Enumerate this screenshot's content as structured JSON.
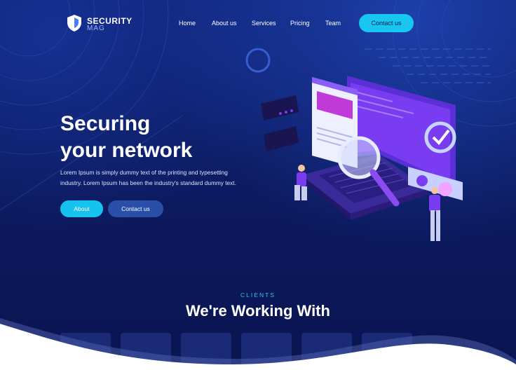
{
  "brand": {
    "name": "SECURITY",
    "sub": "MAG"
  },
  "nav": {
    "items": [
      {
        "label": "Home"
      },
      {
        "label": "About us"
      },
      {
        "label": "Services"
      },
      {
        "label": "Pricing"
      },
      {
        "label": "Team"
      }
    ],
    "cta_label": "Contact us"
  },
  "hero": {
    "title_line1": "Securing",
    "title_line2": "your network",
    "text": "Lorem Ipsum is simply dummy text of the printing and typesetting industry. Lorem Ipsum has been the industry's standard dummy text.",
    "about_label": "About",
    "contact_label": "Contact us"
  },
  "clients": {
    "eyebrow": "CLIENTS",
    "title": "We're Working With"
  },
  "colors": {
    "background": "#0d1a5c",
    "accent": "#17c7ef",
    "secondary_button": "#2a4fa8",
    "purple": "#7a3cf0"
  },
  "icons": [
    "shield-logo-icon",
    "magnifier-icon",
    "laptop-icon"
  ]
}
